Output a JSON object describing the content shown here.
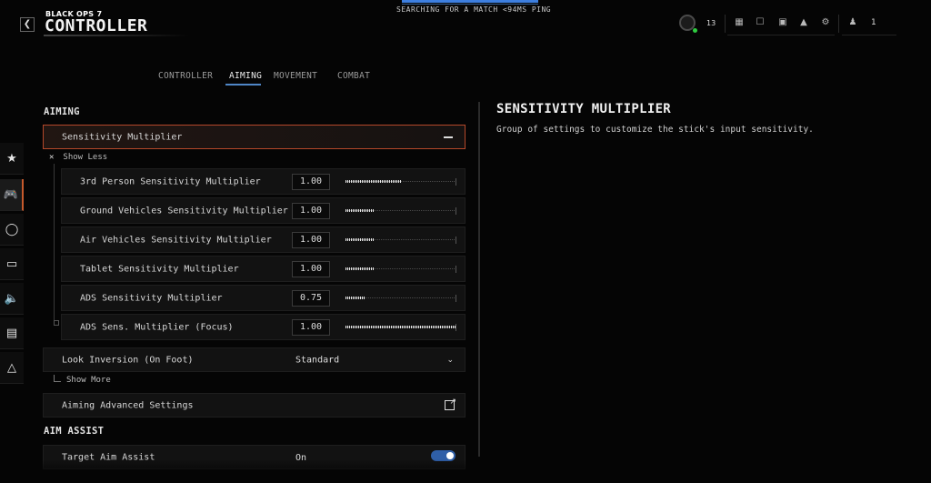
{
  "header": {
    "back_icon": "chevron-left-icon",
    "game_logo": "BLACK OPS 7",
    "title": "CONTROLLER",
    "match_status": "SEARCHING FOR A MATCH <94MS PING",
    "level": "13",
    "party_count": "1",
    "icons": [
      "grid-icon",
      "lock-icon",
      "camera-icon",
      "bell-icon",
      "gear-icon",
      "party-icon"
    ]
  },
  "tabs": [
    {
      "label": "CONTROLLER"
    },
    {
      "label": "AIMING",
      "active": true
    },
    {
      "label": "MOVEMENT"
    },
    {
      "label": "COMBAT"
    }
  ],
  "rail": [
    "star-icon",
    "controller-icon",
    "mouse-icon",
    "display-icon",
    "speaker-icon",
    "interface-icon",
    "network-icon"
  ],
  "aiming": {
    "section_title": "AIMING",
    "group_label": "Sensitivity Multiplier",
    "show_less": "Show Less",
    "sub_settings": [
      {
        "label": "3rd Person Sensitivity Multiplier",
        "value": "1.00",
        "fill": 0.5
      },
      {
        "label": "Ground Vehicles Sensitivity Multiplier",
        "value": "1.00",
        "fill": 0.25
      },
      {
        "label": "Air Vehicles Sensitivity Multiplier",
        "value": "1.00",
        "fill": 0.25
      },
      {
        "label": "Tablet Sensitivity Multiplier",
        "value": "1.00",
        "fill": 0.25
      },
      {
        "label": "ADS Sensitivity Multiplier",
        "value": "0.75",
        "fill": 0.17
      },
      {
        "label": "ADS Sens. Multiplier (Focus)",
        "value": "1.00",
        "fill": 1.0
      }
    ],
    "look_inversion": {
      "label": "Look Inversion (On Foot)",
      "value": "Standard"
    },
    "show_more": "Show More",
    "advanced": {
      "label": "Aiming Advanced Settings"
    }
  },
  "aim_assist": {
    "section_title": "AIM ASSIST",
    "target_aim_assist": {
      "label": "Target Aim Assist",
      "value": "On"
    }
  },
  "detail": {
    "title": "SENSITIVITY MULTIPLIER",
    "description": "Group of settings to customize the stick's input sensitivity."
  },
  "colors": {
    "accent": "#c65a2c",
    "tab_underline": "#4f86c6",
    "toggle": "#2f5fa8"
  }
}
